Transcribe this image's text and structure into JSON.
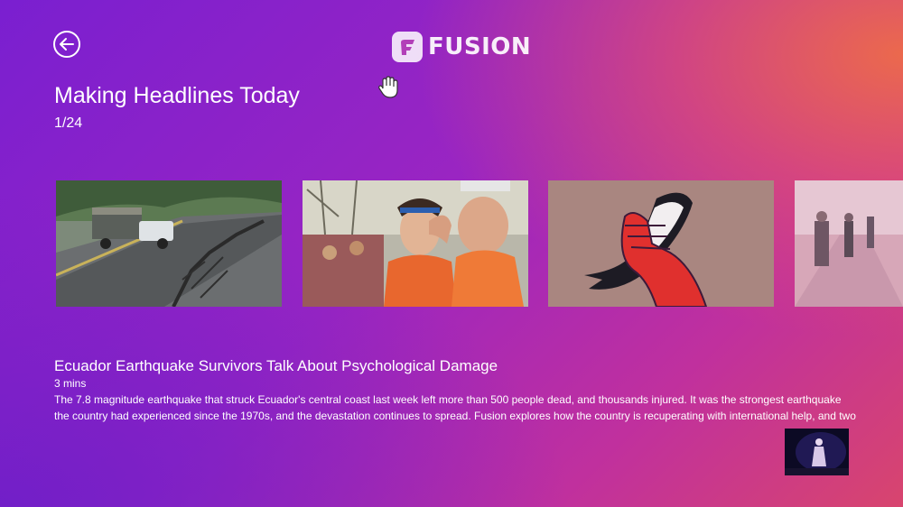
{
  "header": {
    "logo_text": "FUSION",
    "back_icon": "arrow-left-icon"
  },
  "section": {
    "title": "Making Headlines Today",
    "counter": "1/24"
  },
  "carousel": {
    "items": [
      {
        "image": "earthquake-road-cracks-truck"
      },
      {
        "image": "runners-emotional-marathon"
      },
      {
        "image": "hand-holding-orca-illustration"
      },
      {
        "image": "people-walking-hallway"
      }
    ]
  },
  "selected": {
    "title": "Ecuador Earthquake Survivors Talk About Psychological Damage",
    "duration": "3 mins",
    "description": "The 7.8 magnitude earthquake that struck Ecuador's central coast last week left more than 500 people dead, and thousands injured.  It was the strongest earthquake the country had experienced since the 1970s, and the devastation continues to spread. Fusion explores how the country is recuperating with international help, and two"
  },
  "pip": {
    "image": "performer-on-stage-video"
  },
  "cursor": {
    "icon": "hand-cursor-icon"
  }
}
